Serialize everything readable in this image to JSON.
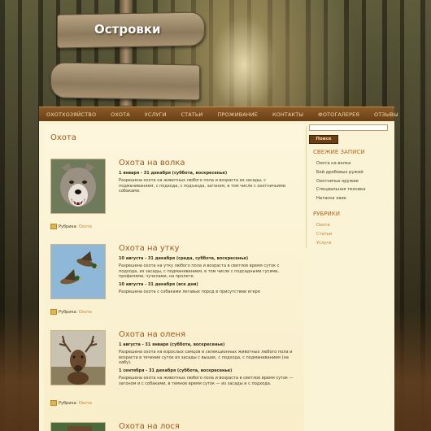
{
  "site": {
    "title": "Островки"
  },
  "nav": {
    "items": [
      {
        "label": "ОХОТХОЗЯЙСТВО"
      },
      {
        "label": "ОХОТА"
      },
      {
        "label": "УСЛУГИ"
      },
      {
        "label": "СТАТЬИ"
      },
      {
        "label": "ПРОЖИВАНИЕ"
      },
      {
        "label": "КОНТАКТЫ"
      },
      {
        "label": "ФОТОГАЛЕРЕЯ"
      },
      {
        "label": "ОТЗЫВЫ"
      }
    ]
  },
  "page": {
    "title": "Охота"
  },
  "articles": [
    {
      "title": "Охота на волка",
      "image": "wolf-photo",
      "dates": [
        {
          "date": "1 января - 31 декабря (суббота, воскресенье)",
          "text": "Разрешена охота на животных любого пола и возраста из засады, с подманиванием, с подхода, с подъезда, загоном, в том числе с охотничьими собаками."
        }
      ],
      "rubric_label": "Рубрика:",
      "rubric_link": "Охота"
    },
    {
      "title": "Охота на утку",
      "image": "ducks-photo",
      "dates": [
        {
          "date": "10 августа - 31 декабря (среда, суббота, воскресенье)",
          "text": "Разрешена охота на утку любого пола и возраста в светлое время суток с подхода, из засады, с подманиванием, в том числе с подсадными гусями, профилями, чучелами, на пролете."
        },
        {
          "date": "10 августа - 31 декабря (все дни)",
          "text": "Разрешена охота с собаками легавых пород в присутствии егеря"
        }
      ],
      "rubric_label": "Рубрика:",
      "rubric_link": "Охота"
    },
    {
      "title": "Охота на оленя",
      "image": "deer-photo",
      "dates": [
        {
          "date": "1 августа - 31 января (суббота, воскресенье)",
          "text": "Разрешена охота на взрослых самцов и селекционных животных любого пола и возраста в течение суток из засады с вышек, с подхода, с подманиванием (на хабу)."
        },
        {
          "date": "1 сентября - 31 декабря (суббота, воскресенье)",
          "text": "Разрешена охота на животных любого пола и возраста в светлое время суток — загоном и с собаками, в темное время суток — из засады и с подхода."
        }
      ],
      "rubric_label": "Рубрика:",
      "rubric_link": "Охота"
    },
    {
      "title": "Охота на лося",
      "image": "moose-photo"
    }
  ],
  "sidebar": {
    "search_placeholder": "",
    "search_button": "Поиск",
    "recent_title": "СВЕЖИЕ ЗАПИСИ",
    "recent": [
      "Охота на волка",
      "Бой дробовых ружей",
      "Охотничье оружие",
      "Специальная техника",
      "Натаска лаек"
    ],
    "rubrics_title": "РУБРИКИ",
    "rubrics": [
      "Охота",
      "Статьи",
      "Услуги"
    ]
  },
  "colors": {
    "accent": "#9a5a1e",
    "link": "#c77a2a",
    "nav_bg": "#7a4a1e",
    "content_bg": "#fbf3d6"
  }
}
